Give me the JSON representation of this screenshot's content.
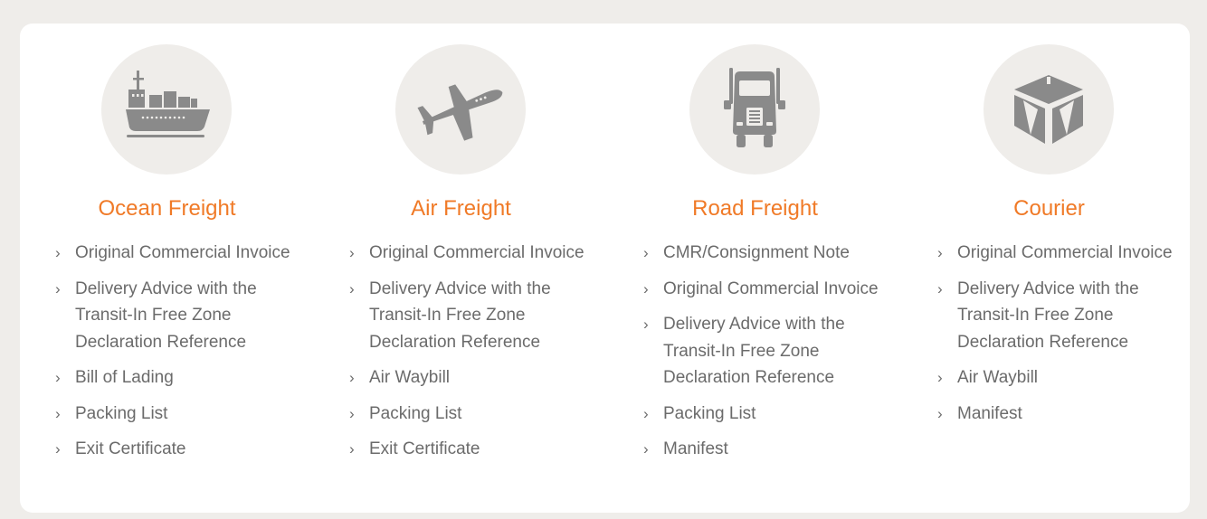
{
  "columns": [
    {
      "id": "ocean",
      "title": "Ocean Freight",
      "icon": "ship-icon",
      "items": [
        "Original Commercial Invoice",
        "Delivery Advice with the Transit-In Free Zone Declaration Reference",
        "Bill of Lading",
        "Packing List",
        "Exit Certificate"
      ]
    },
    {
      "id": "air",
      "title": "Air Freight",
      "icon": "airplane-icon",
      "items": [
        "Original Commercial Invoice",
        "Delivery Advice with the Transit-In Free Zone Declaration Reference",
        "Air Waybill",
        "Packing List",
        "Exit Certificate"
      ]
    },
    {
      "id": "road",
      "title": "Road Freight",
      "icon": "truck-icon",
      "items": [
        "CMR/Consignment Note",
        "Original Commercial Invoice",
        "Delivery Advice with the Transit-In Free Zone Declaration Reference",
        "Packing List",
        "Manifest"
      ]
    },
    {
      "id": "courier",
      "title": "Courier",
      "icon": "package-box-icon",
      "items": [
        "Original Commercial Invoice",
        "Delivery Advice with the Transit-In Free Zone Declaration Reference",
        "Air Waybill",
        "Manifest"
      ]
    }
  ],
  "colors": {
    "accent": "#f07a27",
    "text": "#6b6b6b",
    "icon": "#8a8a8a",
    "circle": "#efedea",
    "page_bg": "#efedea",
    "card_bg": "#ffffff"
  }
}
